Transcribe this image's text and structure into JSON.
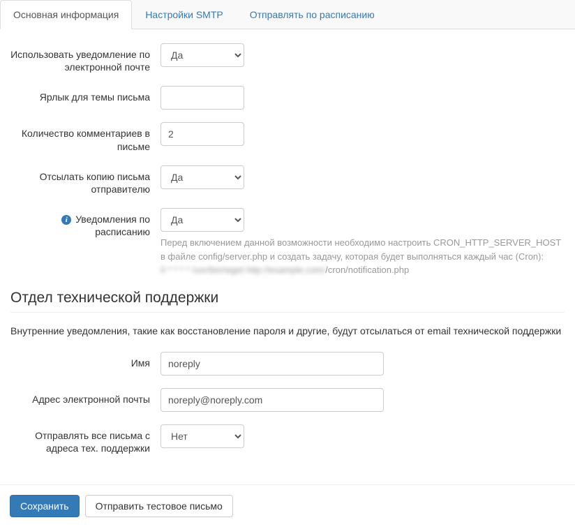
{
  "tabs": {
    "t0": "Основная информация",
    "t1": "Настройки SMTP",
    "t2": "Отправлять по расписанию"
  },
  "fields": {
    "use_email_notification": {
      "label": "Использовать уведомление по электронной почте",
      "value": "Да"
    },
    "subject_label": {
      "label": "Ярлык для темы письма",
      "value": ""
    },
    "comments_count": {
      "label": "Количество комментариев в письме",
      "value": "2"
    },
    "send_copy": {
      "label": "Отсылать копию письма отправителю",
      "value": "Да"
    },
    "scheduled_notifications": {
      "label": "Уведомления по расписанию",
      "value": "Да"
    },
    "schedule_help1": "Перед включением данной возможности необходимо настроить CRON_HTTP_SERVER_HOST в файле config/server.php и создать задачу, которая будет выполняться каждый час (Cron):",
    "schedule_help_blur": "0 * * * * /usr/bin/wget http://example.com/",
    "schedule_help_tail": "/cron/notification.php"
  },
  "support_section": {
    "title": "Отдел технической поддержки",
    "desc": "Внутренние уведомления, такие как восстановление пароля и другие, будут отсылаться от email технической поддержки",
    "name": {
      "label": "Имя",
      "value": "noreply"
    },
    "email": {
      "label": "Адрес электронной почты",
      "value": "noreply@noreply.com"
    },
    "send_all_from_support": {
      "label": "Отправлять все письма с адреса тех. поддержки",
      "value": "Нет"
    }
  },
  "footer": {
    "save": "Сохранить",
    "send_test": "Отправить тестовое письмо"
  }
}
